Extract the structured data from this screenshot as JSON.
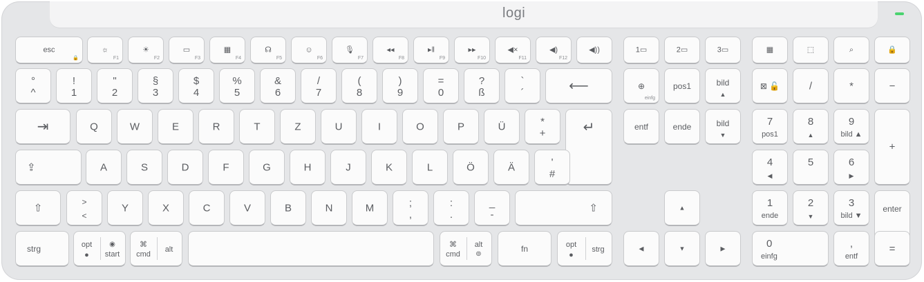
{
  "brand": "logi",
  "status_led_color": "#4ad36f",
  "rows": {
    "f": {
      "esc": "esc",
      "f1": "F1",
      "f2": "F2",
      "f3": "F3",
      "f4": "F4",
      "f5": "F5",
      "f6": "F6",
      "f7": "F7",
      "f8": "F8",
      "f9": "F9",
      "f10": "F10",
      "f11": "F11",
      "f12": "F12",
      "g1": "☼",
      "g2": "☀",
      "g3": "▭",
      "g4": "▦",
      "g5": "☊",
      "g6": "☺",
      "g7": "🎙",
      "g8": "◂◂",
      "g9": "▸‖",
      "g10": "▸▸",
      "g11": "◀×",
      "g12": "◀)",
      "g13": "◀))",
      "ch1": "1▭",
      "ch2": "2▭",
      "ch3": "3▭",
      "calc": "▦",
      "shot": "⬚",
      "search": "⌕",
      "lock": "🔒"
    },
    "num": {
      "k1t": "°",
      "k1b": "^",
      "k2t": "!",
      "k2b": "1",
      "k3t": "\"",
      "k3b": "2",
      "k4t": "§",
      "k4b": "3",
      "k5t": "$",
      "k5b": "4",
      "k6t": "%",
      "k6b": "5",
      "k7t": "&",
      "k7b": "6",
      "k8t": "/",
      "k8b": "7",
      "k9t": "(",
      "k9b": "8",
      "k10t": ")",
      "k10b": "9",
      "k11t": "=",
      "k11b": "0",
      "k12t": "?",
      "k12b": "ß",
      "k13t": "`",
      "k13b": "´",
      "back": "⟵"
    },
    "q": [
      "Q",
      "W",
      "E",
      "R",
      "T",
      "Z",
      "U",
      "I",
      "O",
      "P",
      "Ü"
    ],
    "q_plus_t": "*",
    "q_plus_b": "+",
    "tab": "⇥",
    "enter": "↵",
    "a": [
      "A",
      "S",
      "D",
      "F",
      "G",
      "H",
      "J",
      "K",
      "L",
      "Ö",
      "Ä"
    ],
    "a_hash_t": "'",
    "a_hash_b": "#",
    "caps": "⇪",
    "shift": "⇧",
    "angle_t": ">",
    "angle_b": "<",
    "y": [
      "Y",
      "X",
      "C",
      "V",
      "B",
      "N",
      "M"
    ],
    "comma_t": ";",
    "comma_b": ",",
    "period_t": ":",
    "period_b": ".",
    "minus_t": "_",
    "minus_b": "-",
    "bottom": {
      "strg": "strg",
      "opt": "opt",
      "start": "start",
      "cmd": "cmd",
      "alt": "alt",
      "cmd_sym": "⌘",
      "fn": "fn",
      "opt2": "opt",
      "strg2": "strg"
    }
  },
  "nav": {
    "einfg": "einfg",
    "pos1": "pos1",
    "bild_up": "bild",
    "entf": "entf",
    "ende": "ende",
    "bild_down": "bild",
    "up": "▲",
    "down": "▼",
    "left": "◀",
    "right": "▶"
  },
  "numpad": {
    "lock": "⊠ 🔓",
    "div": "/",
    "mul": "*",
    "minus": "−",
    "n7": "7",
    "n7s": "pos1",
    "n8": "8",
    "n8s": "▲",
    "n9": "9",
    "n9s": "bild ▲",
    "plus": "+",
    "n4": "4",
    "n4s": "◀",
    "n5": "5",
    "n6": "6",
    "n6s": "▶",
    "n1": "1",
    "n1s": "ende",
    "n2": "2",
    "n2s": "▼",
    "n3": "3",
    "n3s": "bild ▼",
    "enter": "enter",
    "n0": "0",
    "n0s": "einfg",
    "dec_t": ",",
    "dec_s": "entf",
    "eq": "="
  }
}
